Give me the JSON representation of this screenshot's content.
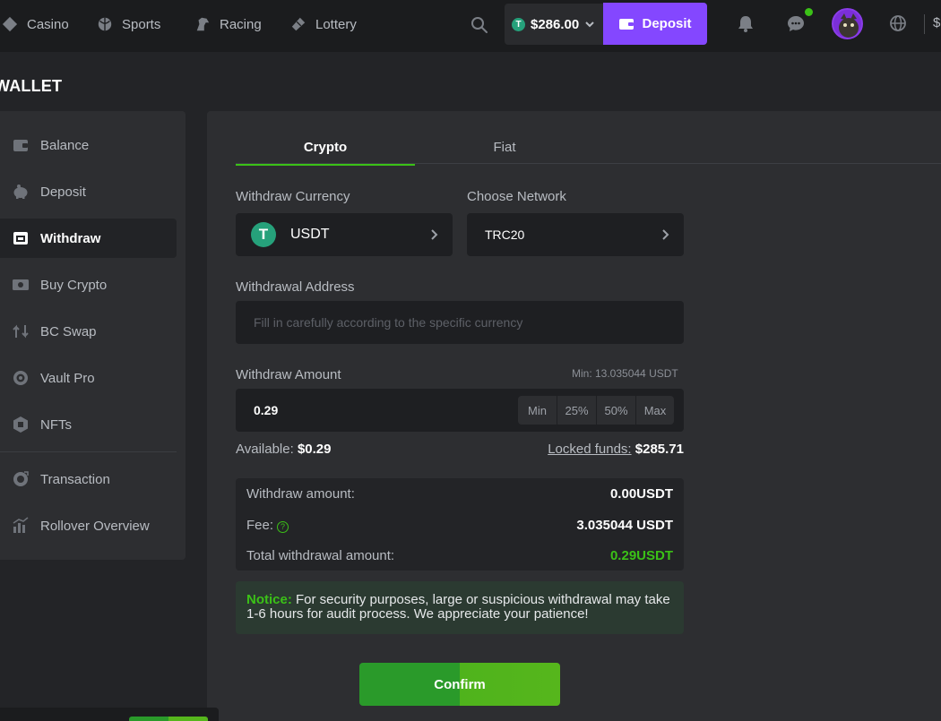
{
  "topnav": {
    "items": [
      {
        "label": "Casino",
        "icon": "casino-icon"
      },
      {
        "label": "Sports",
        "icon": "sports-icon"
      },
      {
        "label": "Racing",
        "icon": "racing-icon"
      },
      {
        "label": "Lottery",
        "icon": "lottery-icon"
      }
    ],
    "balance": "$286.00",
    "balance_coin": "T",
    "deposit_label": "Deposit",
    "right_text": "$"
  },
  "page_title": "WALLET",
  "sidebar": {
    "items": [
      {
        "label": "Balance",
        "icon": "wallet-icon",
        "active": false
      },
      {
        "label": "Deposit",
        "icon": "piggy-bank-icon",
        "active": false
      },
      {
        "label": "Withdraw",
        "icon": "withdraw-icon",
        "active": true
      },
      {
        "label": "Buy Crypto",
        "icon": "cash-icon",
        "active": false
      },
      {
        "label": "BC Swap",
        "icon": "swap-icon",
        "active": false
      },
      {
        "label": "Vault Pro",
        "icon": "vault-icon",
        "active": false
      },
      {
        "label": "NFTs",
        "icon": "nft-icon",
        "active": false
      },
      {
        "label": "Transaction",
        "icon": "transaction-icon",
        "active": false
      },
      {
        "label": "Rollover Overview",
        "icon": "chart-icon",
        "active": false
      }
    ]
  },
  "main": {
    "tabs": [
      {
        "label": "Crypto",
        "active": true
      },
      {
        "label": "Fiat",
        "active": false
      }
    ],
    "currency_label": "Withdraw Currency",
    "currency_value": "USDT",
    "currency_logo": "T",
    "network_label": "Choose Network",
    "network_value": "TRC20",
    "address_label": "Withdrawal Address",
    "address_placeholder": "Fill in carefully according to the specific currency",
    "amount_label": "Withdraw Amount",
    "min_text": "Min: 13.035044 USDT",
    "amount_value": "0.29",
    "pct_buttons": [
      "Min",
      "25%",
      "50%",
      "Max"
    ],
    "available_label": "Available:",
    "available_value": "$0.29",
    "locked_label": "Locked funds:",
    "locked_value": "$285.71",
    "summary": {
      "withdraw_label": "Withdraw amount:",
      "withdraw_value": "0.00USDT",
      "fee_label": "Fee:",
      "fee_value": "3.035044 USDT",
      "total_label": "Total withdrawal amount:",
      "total_value": "0.29USDT"
    },
    "notice_label": "Notice:",
    "notice_text": "For security purposes, large or suspicious withdrawal may take 1-6 hours for audit process. We appreciate your patience!",
    "confirm_label": "Confirm"
  },
  "colors": {
    "accent_green": "#3bc117",
    "deposit_purple": "#8447ff",
    "tether_green": "#26a17b"
  }
}
